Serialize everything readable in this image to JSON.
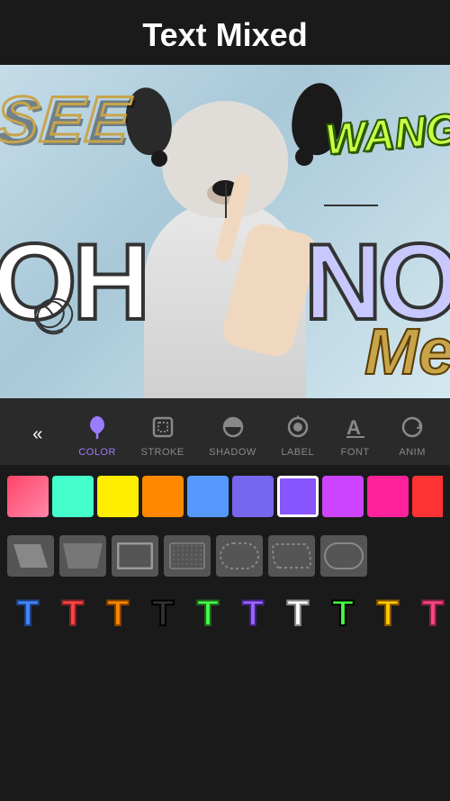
{
  "header": {
    "title": "Text Mixed"
  },
  "canvas": {
    "texts": {
      "see": "SEE",
      "wang": "WANG",
      "oh": "OH",
      "no": "NO",
      "me": "Me"
    }
  },
  "toolbar": {
    "back_icon": "«",
    "items": [
      {
        "id": "color",
        "label": "COLOR",
        "active": true
      },
      {
        "id": "stroke",
        "label": "STROKE",
        "active": false
      },
      {
        "id": "shadow",
        "label": "SHADOW",
        "active": false
      },
      {
        "id": "label",
        "label": "LABEL",
        "active": false
      },
      {
        "id": "font",
        "label": "FONT",
        "active": false
      },
      {
        "id": "anim",
        "label": "ANIM",
        "active": false
      }
    ]
  },
  "colors": [
    {
      "id": 1,
      "bg": "linear-gradient(to right, #ff4466, #ff88aa)",
      "selected": false
    },
    {
      "id": 2,
      "bg": "#44ffcc",
      "selected": false
    },
    {
      "id": 3,
      "bg": "#ffee00",
      "selected": false
    },
    {
      "id": 4,
      "bg": "#ff8800",
      "selected": false
    },
    {
      "id": 5,
      "bg": "#8866ff",
      "selected": false
    },
    {
      "id": 6,
      "bg": "#5599ff",
      "selected": false
    },
    {
      "id": 7,
      "bg": "#8855ff",
      "selected": true
    },
    {
      "id": 8,
      "bg": "#cc44ff",
      "selected": false
    },
    {
      "id": 9,
      "bg": "#ff2299",
      "selected": false
    },
    {
      "id": 10,
      "bg": "#ff3333",
      "selected": false
    },
    {
      "id": 11,
      "bg": "#colorful",
      "selected": false
    }
  ],
  "shapes": [
    {
      "id": 1,
      "type": "parallelogram-left"
    },
    {
      "id": 2,
      "type": "trapezoid"
    },
    {
      "id": 3,
      "type": "rectangle"
    },
    {
      "id": 4,
      "type": "dotted-rectangle"
    },
    {
      "id": 5,
      "type": "dotted-rounded"
    },
    {
      "id": 6,
      "type": "rounded-parallelogram"
    },
    {
      "id": 7,
      "type": "pill"
    }
  ],
  "font_styles": [
    {
      "id": 1,
      "color": "#4488ff",
      "stroke": "#224488"
    },
    {
      "id": 2,
      "color": "#ff4444",
      "stroke": "#882222"
    },
    {
      "id": 3,
      "color": "#ff8800",
      "stroke": "#884400"
    },
    {
      "id": 4,
      "color": "#222222",
      "stroke": "#000000"
    },
    {
      "id": 5,
      "color": "#44ff44",
      "stroke": "#226622"
    },
    {
      "id": 6,
      "color": "#8844ff",
      "stroke": "#442288"
    },
    {
      "id": 7,
      "color": "#ffffff",
      "stroke": "#888888"
    },
    {
      "id": 8,
      "color": "#44ff44",
      "stroke": "#000000"
    },
    {
      "id": 9,
      "color": "#ffcc00",
      "stroke": "#885500"
    },
    {
      "id": 10,
      "color": "#ff4488",
      "stroke": "#882244"
    }
  ]
}
